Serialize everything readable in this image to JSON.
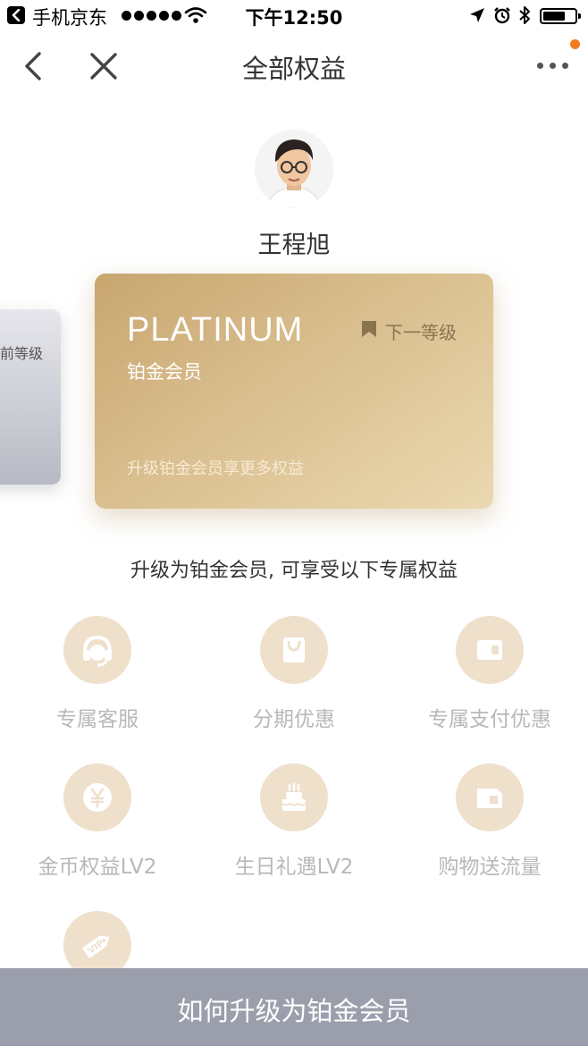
{
  "status_bar": {
    "carrier": "手机京东",
    "time": "下午12:50",
    "battery_level": 0.7
  },
  "nav": {
    "title": "全部权益"
  },
  "user": {
    "name": "王程旭"
  },
  "cards": {
    "previous_label": "前等级",
    "current": {
      "level": "PLATINUM",
      "subtitle": "铂金会员",
      "badge": "下一等级",
      "tagline": "升级铂金会员享更多权益"
    }
  },
  "benefits_title": "升级为铂金会员, 可享受以下专属权益",
  "benefits": [
    {
      "label": "专属客服",
      "icon": "customer-service-icon"
    },
    {
      "label": "分期优惠",
      "icon": "shopping-bag-icon"
    },
    {
      "label": "专属支付优惠",
      "icon": "wallet-icon"
    },
    {
      "label": "金币权益LV2",
      "icon": "yen-coin-icon"
    },
    {
      "label": "生日礼遇LV2",
      "icon": "birthday-cake-icon"
    },
    {
      "label": "购物送流量",
      "icon": "data-card-icon"
    },
    {
      "label": "",
      "icon": "vip-tag-icon"
    }
  ],
  "bottom_button": {
    "label": "如何升级为铂金会员"
  },
  "colors": {
    "accent_dot": "#f47a21",
    "card_gold": "#d9be8e",
    "benefit_icon_bg": "#efe0cc",
    "bottom_button_bg": "#9b9fac"
  }
}
